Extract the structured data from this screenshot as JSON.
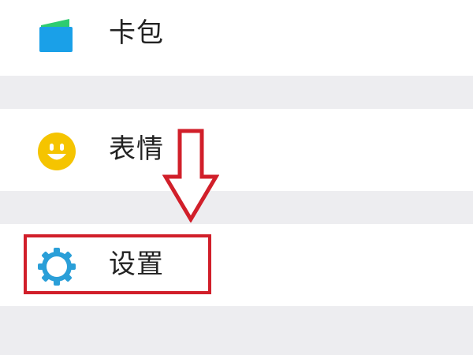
{
  "menu": {
    "items": [
      {
        "label": "卡包",
        "icon": "wallet-icon"
      },
      {
        "label": "表情",
        "icon": "emoji-icon"
      },
      {
        "label": "设置",
        "icon": "settings-gear-icon"
      }
    ]
  },
  "annotation": {
    "arrow": "down-arrow",
    "highlight_target": "设置",
    "color": "#d11f2a"
  },
  "colors": {
    "wallet_green": "#2ecc71",
    "wallet_blue": "#1aa0e8",
    "emoji_yellow": "#f5c400",
    "gear_blue": "#2a9fd8",
    "divider_gray": "#ededf0"
  }
}
